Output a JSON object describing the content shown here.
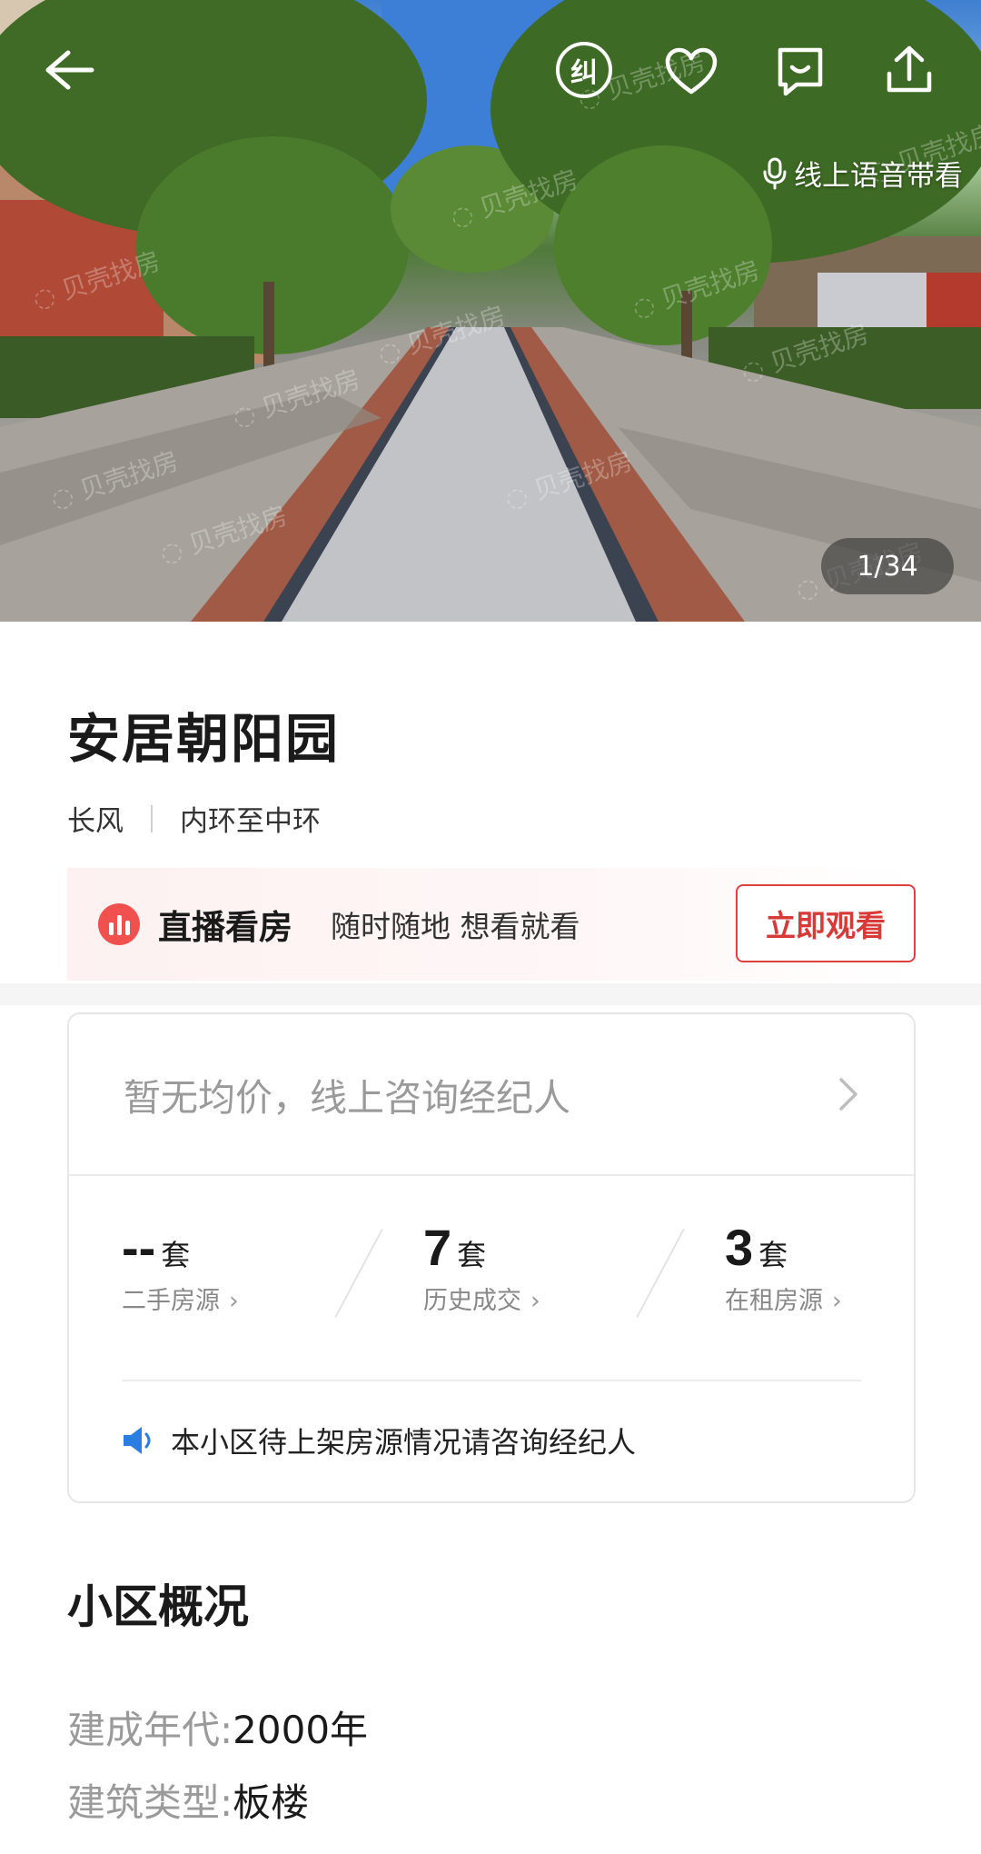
{
  "hero": {
    "voice_tour_label": "线上语音带看",
    "page_counter": "1/34",
    "current_image": 1,
    "total_images": 34,
    "watermark": "贝壳找房",
    "top_icons": [
      "back-arrow-icon",
      "correction-icon",
      "heart-icon",
      "chat-icon",
      "share-icon"
    ],
    "correction_glyph": "纠"
  },
  "community": {
    "name": "安居朝阳园",
    "district": "长风",
    "ring": "内环至中环"
  },
  "live": {
    "title": "直播看房",
    "slogan": "随时随地 想看就看",
    "button": "立即观看",
    "accent_color": "#f0514f"
  },
  "stats": {
    "avg_price_text": "暂无均价，线上咨询经纪人",
    "items": [
      {
        "value": "--",
        "unit": "套",
        "label": "二手房源"
      },
      {
        "value": "7",
        "unit": "套",
        "label": "历史成交"
      },
      {
        "value": "3",
        "unit": "套",
        "label": "在租房源"
      }
    ],
    "notice": "本小区待上架房源情况请咨询经纪人"
  },
  "overview": {
    "title": "小区概况",
    "rows": [
      {
        "key": "建成年代:",
        "value": "2000年"
      },
      {
        "key": "建筑类型:",
        "value": "板楼"
      }
    ]
  }
}
